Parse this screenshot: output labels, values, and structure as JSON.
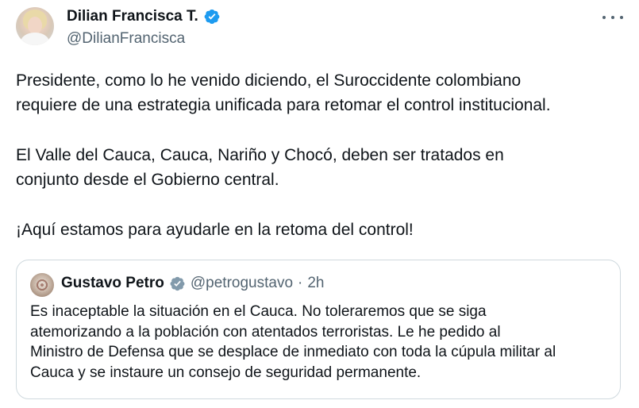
{
  "tweet": {
    "author": {
      "display_name": "Dilian Francisca T.",
      "handle": "@DilianFrancisca",
      "verified_icon": "verified-badge-icon",
      "verified_color": "#1d9bf0"
    },
    "more_icon": "more-options-icon",
    "text": {
      "paragraph1_line1": "Presidente, como lo he venido diciendo, el Suroccidente colombiano",
      "paragraph1_line2": "requiere de una estrategia unificada para retomar el control institucional.",
      "paragraph2_line1": "El Valle del Cauca, Cauca, Nariño y Chocó, deben ser tratados en",
      "paragraph2_line2": "conjunto desde el Gobierno central.",
      "paragraph3": "¡Aquí estamos para ayudarle en la retoma del control!"
    }
  },
  "quoted_tweet": {
    "author": {
      "display_name": "Gustavo Petro",
      "handle": "@petrogustavo",
      "separator": "·",
      "time": "2h",
      "badge_icon": "government-verified-badge-icon",
      "badge_color": "#829aab"
    },
    "text": {
      "line1": "Es inaceptable la situación en el Cauca. No toleraremos que se siga",
      "line2": "atemorizando a la población con atentados terroristas. Le he pedido al",
      "line3": "Ministro de Defensa que se desplace de inmediato con toda la cúpula militar al",
      "line4": "Cauca y se instaure un consejo de seguridad permanente."
    }
  }
}
